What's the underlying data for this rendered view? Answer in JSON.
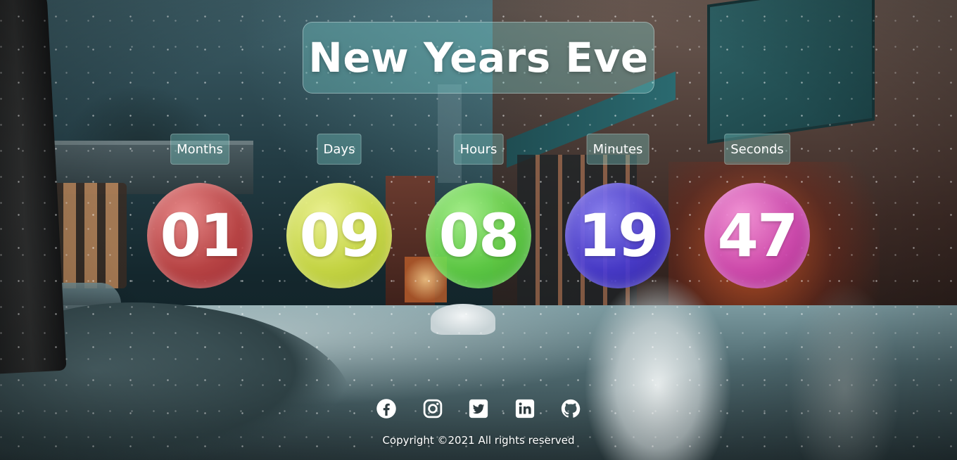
{
  "title": "New Years Eve",
  "countdown": [
    {
      "label": "Months",
      "value": "01",
      "color": "#d85a5a"
    },
    {
      "label": "Days",
      "value": "09",
      "color": "#d6e54a"
    },
    {
      "label": "Hours",
      "value": "08",
      "color": "#6fd84a"
    },
    {
      "label": "Minutes",
      "value": "19",
      "color": "#4a3fd6"
    },
    {
      "label": "Seconds",
      "value": "47",
      "color": "#d04ab8"
    }
  ],
  "footer": {
    "socials": [
      {
        "icon": "facebook-icon"
      },
      {
        "icon": "instagram-icon"
      },
      {
        "icon": "twitter-icon"
      },
      {
        "icon": "linkedin-icon"
      },
      {
        "icon": "github-icon"
      }
    ],
    "copyright": "Copyright ©2021 All rights reserved"
  }
}
